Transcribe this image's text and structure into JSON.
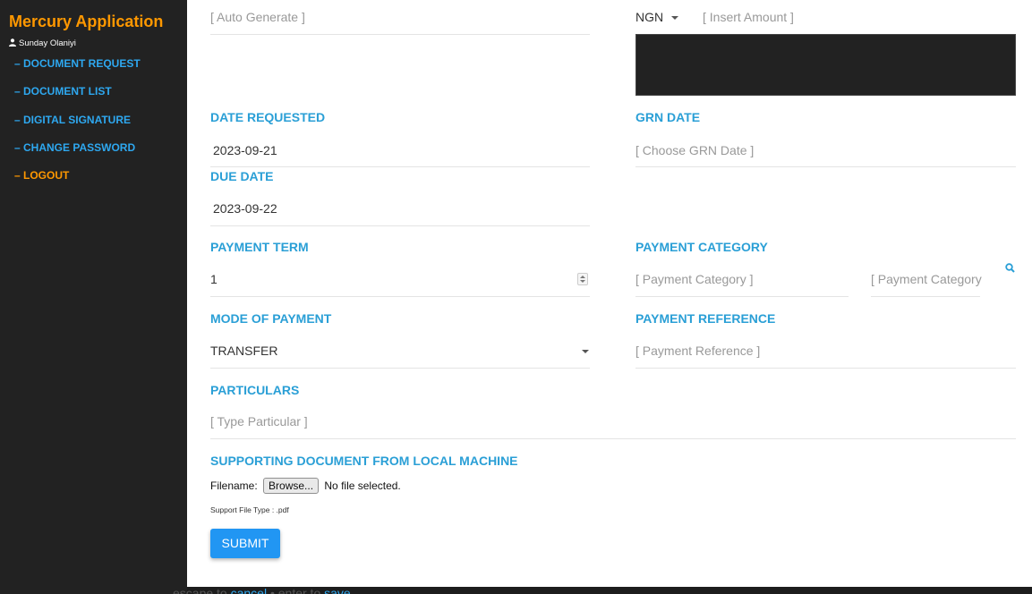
{
  "sidebar": {
    "app_title": "Mercury Application",
    "user_name": "Sunday Olaniyi",
    "items": [
      {
        "label": "– DOCUMENT REQUEST"
      },
      {
        "label": "– DOCUMENT LIST"
      },
      {
        "label": "– DIGITAL SIGNATURE"
      },
      {
        "label": "– CHANGE PASSWORD"
      },
      {
        "label": "– LOGOUT"
      }
    ]
  },
  "form": {
    "auto_generate_placeholder": "[ Auto Generate ]",
    "currency": "NGN",
    "amount_placeholder": "[ Insert Amount ]",
    "date_requested_label": "DATE REQUESTED",
    "date_requested_value": "2023-09-21",
    "grn_date_label": "GRN DATE",
    "grn_date_placeholder": "[ Choose GRN Date ]",
    "due_date_label": "DUE DATE",
    "due_date_value": "2023-09-22",
    "payment_term_label": "PAYMENT TERM",
    "payment_term_value": "1",
    "payment_category_label": "PAYMENT CATEGORY",
    "payment_category_placeholder": "[ Payment Category ]",
    "payment_category_placeholder_2": "[ Payment Category",
    "mode_of_payment_label": "MODE OF PAYMENT",
    "mode_of_payment_value": "TRANSFER",
    "payment_reference_label": "PAYMENT REFERENCE",
    "payment_reference_placeholder": "[ Payment Reference ]",
    "particulars_label": "PARTICULARS",
    "particulars_placeholder": "[ Type Particular ]",
    "supporting_doc_label": "SUPPORTING DOCUMENT FROM LOCAL MACHINE",
    "filename_label": "Filename:",
    "browse_label": "Browse...",
    "no_file_text": "No file selected.",
    "support_file_type": "Support File Type : .pdf",
    "submit_label": "SUBMIT"
  },
  "bottom_hint": {
    "escape_text": "escape to",
    "cancel_text": "cancel",
    "separator": "• enter to",
    "save_text": "save"
  },
  "colors": {
    "accent_blue": "#2a9fd6",
    "brand_orange": "#ff9800",
    "sidebar_bg": "#222222",
    "submit_blue": "#2196f3"
  }
}
